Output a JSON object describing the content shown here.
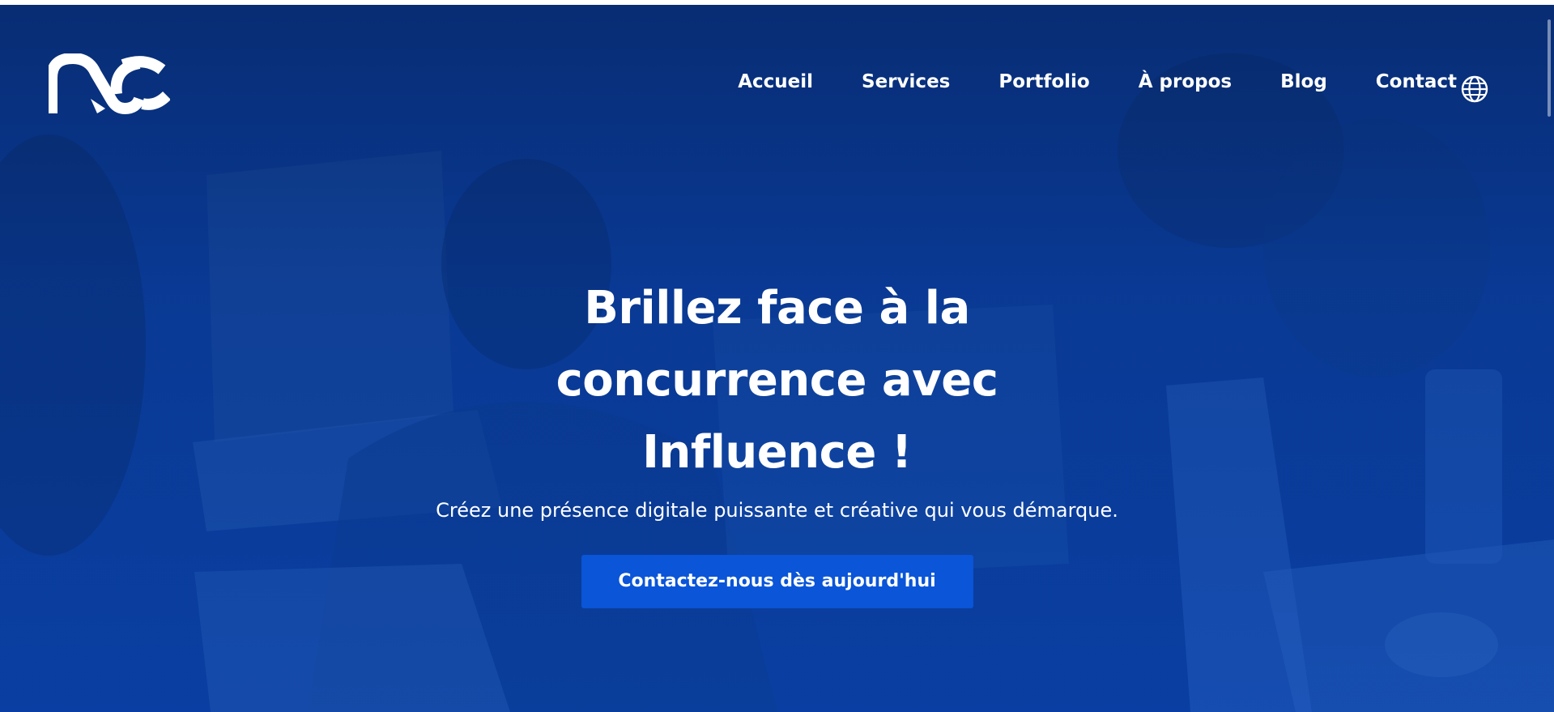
{
  "brand": {
    "logo_name": "nc-logo",
    "accent_color": "#0a55d8",
    "hero_bg_color": "#0a3c98"
  },
  "nav": {
    "items": [
      {
        "label": "Accueil"
      },
      {
        "label": "Services"
      },
      {
        "label": "Portfolio"
      },
      {
        "label": "À propos"
      },
      {
        "label": "Blog"
      },
      {
        "label": "Contact"
      }
    ],
    "language_icon": "globe-icon"
  },
  "hero": {
    "title_lines": [
      "Brillez face à la",
      "concurrence avec",
      "Influence !"
    ],
    "subtitle": "Créez une présence digitale puissante et créative qui vous démarque.",
    "cta_label": "Contactez-nous dès aujourd'hui"
  }
}
